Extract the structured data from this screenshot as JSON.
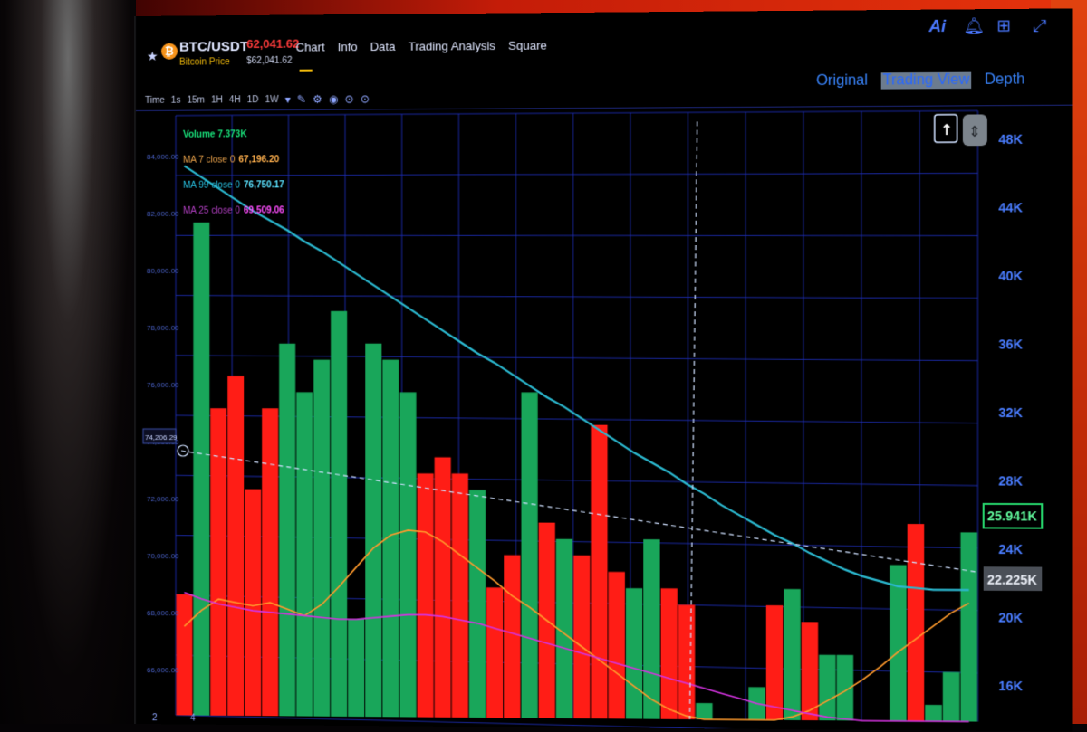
{
  "header": {
    "pair": "BTC/USDT",
    "pair_sub": "Bitcoin Price",
    "price": "62,041.62",
    "price_sub": "$62,041.62",
    "nav": [
      "Chart",
      "Info",
      "Data",
      "Trading Analysis",
      "Square"
    ],
    "view_tabs": [
      "Original",
      "Trading View",
      "Depth"
    ],
    "active_view": "Trading View",
    "icons": [
      "ai-icon",
      "bell-icon",
      "grid-icon",
      "expand-icon"
    ]
  },
  "toolbar": {
    "intervals": [
      "Time",
      "1s",
      "15m",
      "1H",
      "4H",
      "1D",
      "1W"
    ],
    "tools": [
      "draw-icon",
      "indicator-icon",
      "camera-icon",
      "settings-icon",
      "settings-icon"
    ]
  },
  "indicators": {
    "volume": "Volume  7.373K",
    "ma7": "MA 7 close 0",
    "ma7_value": "67,196.20",
    "ma99": "MA 99 close 0",
    "ma99_value": "76,750.17",
    "ma25": "MA 25 close 0",
    "ma25_value": "69,509.06"
  },
  "colors": {
    "up": "#19a65a",
    "down": "#ff1d16",
    "grid": "#1f2fb8",
    "ma99": "#2bb8cf",
    "ma7": "#ff9a2c",
    "ma25": "#d433e0",
    "axis_text": "#4a7dff"
  },
  "chart_data": {
    "type": "bar",
    "left_axis_ticks": [
      "84,000.00",
      "82,000.00",
      "80,000.00",
      "78,000.00",
      "76,000.00",
      "74,000.00",
      "72,000.00",
      "70,000.00",
      "68,000.00",
      "66,000.00"
    ],
    "right_axis_ticks": [
      "48K",
      "44K",
      "40K",
      "36K",
      "32K",
      "28K",
      "24K",
      "20K",
      "16K"
    ],
    "crosshair_price": "74,206.29",
    "price_label_high": "25.941K",
    "price_label_low": "22.225K",
    "bottom_ticks": [
      "2",
      "4"
    ],
    "ylim": [
      14,
      50
    ],
    "bars": [
      {
        "v": 21.5,
        "c": "down"
      },
      {
        "v": 44.5,
        "c": "up"
      },
      {
        "v": 33,
        "c": "down"
      },
      {
        "v": 35,
        "c": "down"
      },
      {
        "v": 28,
        "c": "down"
      },
      {
        "v": 33,
        "c": "down"
      },
      {
        "v": 37,
        "c": "up"
      },
      {
        "v": 34,
        "c": "up"
      },
      {
        "v": 36,
        "c": "up"
      },
      {
        "v": 39,
        "c": "up"
      },
      {
        "v": 20,
        "c": "up"
      },
      {
        "v": 37,
        "c": "up"
      },
      {
        "v": 36,
        "c": "up"
      },
      {
        "v": 34,
        "c": "up"
      },
      {
        "v": 29,
        "c": "down"
      },
      {
        "v": 30,
        "c": "down"
      },
      {
        "v": 29,
        "c": "down"
      },
      {
        "v": 28,
        "c": "up"
      },
      {
        "v": 22,
        "c": "down"
      },
      {
        "v": 24,
        "c": "down"
      },
      {
        "v": 34,
        "c": "up"
      },
      {
        "v": 26,
        "c": "down"
      },
      {
        "v": 25,
        "c": "up"
      },
      {
        "v": 24,
        "c": "down"
      },
      {
        "v": 32,
        "c": "down"
      },
      {
        "v": 23,
        "c": "down"
      },
      {
        "v": 22,
        "c": "up"
      },
      {
        "v": 25,
        "c": "up"
      },
      {
        "v": 22,
        "c": "down"
      },
      {
        "v": 21,
        "c": "down"
      },
      {
        "v": 15,
        "c": "up"
      },
      {
        "v": 14,
        "c": "down"
      },
      {
        "v": 14,
        "c": "down"
      },
      {
        "v": 16,
        "c": "up"
      },
      {
        "v": 21,
        "c": "down"
      },
      {
        "v": 22,
        "c": "up"
      },
      {
        "v": 20,
        "c": "down"
      },
      {
        "v": 18,
        "c": "up"
      },
      {
        "v": 18,
        "c": "up"
      },
      {
        "v": 14,
        "c": "down"
      },
      {
        "v": 14,
        "c": "down"
      },
      {
        "v": 23.5,
        "c": "up"
      },
      {
        "v": 26,
        "c": "down"
      },
      {
        "v": 15,
        "c": "up"
      },
      {
        "v": 17,
        "c": "up"
      },
      {
        "v": 25.5,
        "c": "up"
      }
    ],
    "series": [
      {
        "name": "MA 99 close 0",
        "color": "#2bb8cf",
        "values": [
          48,
          47.3,
          46.6,
          45.9,
          45.2,
          44.6,
          44.0,
          43.3,
          42.7,
          42.0,
          41.3,
          40.6,
          39.9,
          39.2,
          38.5,
          37.8,
          37.1,
          36.4,
          35.8,
          35.1,
          34.4,
          33.7,
          33.1,
          32.4,
          31.7,
          31.0,
          30.3,
          29.7,
          29.1,
          28.4,
          27.8,
          27.1,
          26.5,
          25.9,
          25.3,
          24.8,
          24.2,
          23.7,
          23.2,
          22.8,
          22.5,
          22.2,
          22.1,
          22.0,
          22.0,
          22.0
        ]
      },
      {
        "name": "MA 7 close 0",
        "color": "#ff9a2c",
        "values": [
          19.5,
          20.5,
          21.2,
          21.0,
          20.8,
          21.0,
          20.6,
          20.2,
          20.9,
          22.0,
          23.2,
          24.4,
          25.2,
          25.5,
          25.4,
          24.8,
          24.0,
          23.2,
          22.4,
          21.5,
          20.8,
          20.0,
          19.2,
          18.4,
          17.6,
          16.8,
          16.0,
          15.2,
          14.6,
          14.2,
          14.0,
          14.0,
          14.0,
          14.0,
          14.0,
          14.2,
          14.6,
          15.2,
          15.8,
          16.5,
          17.3,
          18.2,
          19.0,
          19.8,
          20.6,
          21.2
        ]
      },
      {
        "name": "MA 25 close 0",
        "color": "#d433e0",
        "values": [
          21.6,
          21.2,
          20.9,
          20.7,
          20.5,
          20.4,
          20.3,
          20.2,
          20.1,
          20.0,
          20.0,
          20.1,
          20.2,
          20.3,
          20.3,
          20.2,
          20.0,
          19.8,
          19.5,
          19.2,
          18.9,
          18.6,
          18.3,
          18.0,
          17.7,
          17.4,
          17.1,
          16.8,
          16.5,
          16.2,
          15.9,
          15.6,
          15.3,
          15.0,
          14.8,
          14.6,
          14.4,
          14.2,
          14.1,
          14.0,
          14.0,
          14.0,
          14.0,
          14.0,
          14.0,
          14.0
        ]
      }
    ]
  }
}
